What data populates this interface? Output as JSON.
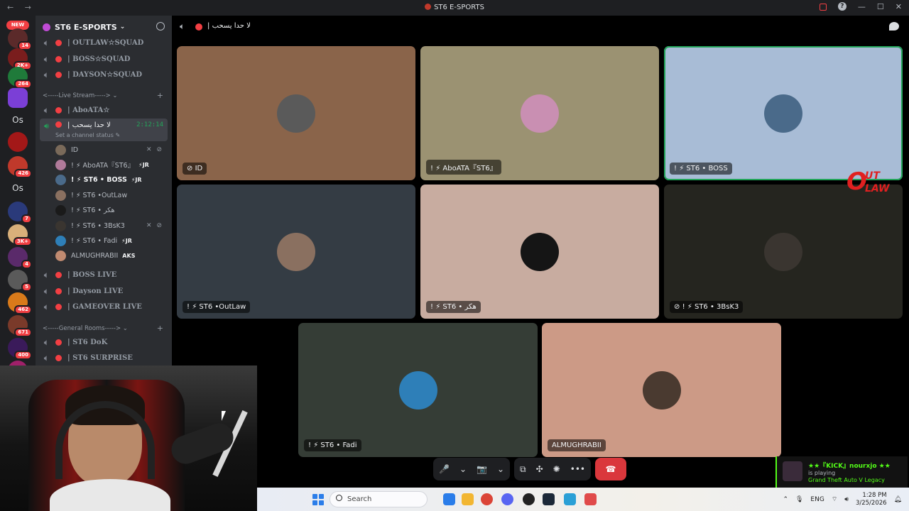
{
  "window": {
    "title": "ST6 E-SPORTS",
    "nav": "← →"
  },
  "guilds": {
    "new_label": "NEW",
    "items": [
      {
        "badge": "14",
        "color": "#5b2a2a"
      },
      {
        "badge": "2K+",
        "color": "#7a1d1d"
      },
      {
        "badge": "264",
        "color": "#1f7a3a"
      },
      {
        "badge": "",
        "color": "#7b3fd6"
      },
      {
        "label": "Os"
      },
      {
        "badge": "",
        "color": "#a31818"
      },
      {
        "badge": "426",
        "color": "#c0392b"
      },
      {
        "label": "Os"
      },
      {
        "badge": "7",
        "color": "#2a3a7a"
      },
      {
        "badge": "3K+",
        "color": "#d9b07a"
      },
      {
        "badge": "4",
        "color": "#5a2a6a"
      },
      {
        "badge": "5",
        "color": "#5a5a5a"
      },
      {
        "badge": "462",
        "color": "#d97a1a"
      },
      {
        "badge": "671",
        "color": "#7a3a2a"
      },
      {
        "badge": "400",
        "color": "#3a1a5a"
      },
      {
        "badge": "686",
        "color": "#a0206a"
      }
    ]
  },
  "server": {
    "name": "ST6 E-SPORTS"
  },
  "channels_top": [
    {
      "name": "| OUTLAW☆SQUAD"
    },
    {
      "name": "| BOSS☆SQUAD"
    },
    {
      "name": "| DAYSON☆SQUAD"
    }
  ],
  "category_live": {
    "label": "<-----Live Stream----->"
  },
  "channel_aboata": {
    "name": "| AboATA☆"
  },
  "active_channel": {
    "name": "| لا حدا يسحب",
    "timer": "2:12:14",
    "status_hint": "Set a channel status ✎"
  },
  "voice_users": [
    {
      "name": "ID",
      "tag": "",
      "icons": "✕ ⊘",
      "bold": false
    },
    {
      "name": "! ⚡ AboATA『ST6』",
      "tag": "⚡JR",
      "icons": "",
      "bold": false
    },
    {
      "name": "! ⚡ ST6 • BOSS",
      "tag": "⚡JR",
      "icons": "",
      "bold": true
    },
    {
      "name": "! ⚡ ST6 •OutLaw",
      "tag": "",
      "icons": "",
      "bold": false
    },
    {
      "name": "! ⚡ ST6 • هكر",
      "tag": "",
      "icons": "",
      "bold": false
    },
    {
      "name": "! ⚡ ST6 • 3BsK3",
      "tag": "",
      "icons": "✕ ⊘",
      "bold": false
    },
    {
      "name": "! ⚡ ST6 • Fadi",
      "tag": "⚡JR",
      "icons": "",
      "bold": false
    },
    {
      "name": "ALMUGHRABII",
      "tag": "AKS",
      "icons": "",
      "bold": false
    }
  ],
  "channels_live": [
    {
      "name": "| BOSS LIVE"
    },
    {
      "name": "| Dayson LIVE"
    },
    {
      "name": "| GAMEOVER LIVE"
    }
  ],
  "category_general": {
    "label": "<-----General Rooms----->"
  },
  "channels_general": [
    {
      "name": "| ST6 DoK"
    },
    {
      "name": "| ST6 SURPRISE"
    }
  ],
  "call_header": {
    "channel": "| لا حدا يسحب"
  },
  "tiles": [
    {
      "label": "ID",
      "icon": "⊘",
      "bg": "#8a644a",
      "avatar": "#5a5a5a"
    },
    {
      "label": "! ⚡ AboATA『ST6』",
      "icon": "",
      "bg": "#9b9272",
      "avatar": "#c98fb2"
    },
    {
      "label": "! ⚡ ST6 • BOSS",
      "icon": "",
      "bg": "#a8bcd6",
      "avatar": "#4a6a8a",
      "speaking": true
    },
    {
      "label": "! ⚡ ST6 •OutLaw",
      "icon": "",
      "bg": "#343c44",
      "avatar": "#8a7060"
    },
    {
      "label": "! ⚡ ST6 • هكر",
      "icon": "",
      "bg": "#c8aca0",
      "avatar": "#151515"
    },
    {
      "label": "! ⚡ ST6 • 3BsK3",
      "icon": "⊘",
      "bg": "#25251f",
      "avatar": "#3a3530"
    },
    {
      "label": "! ⚡ ST6 • Fadi",
      "icon": "",
      "bg": "#353d36",
      "avatar": "#2e7fb8"
    },
    {
      "label": "ALMUGHRABII",
      "icon": "",
      "bg": "#cc9a86",
      "avatar": "#4a3a30"
    }
  ],
  "logo": {
    "o": "O",
    "line1": "UT",
    "line2": "LAW"
  },
  "controls": {
    "mic": "🎤",
    "camera": "📷",
    "share": "⧉",
    "activity": "✣",
    "soundboard": "✺",
    "more": "•••",
    "hangup": "☎",
    "chevron": "⌄"
  },
  "taskbar": {
    "search_placeholder": "Search",
    "lang": "ENG",
    "time": "1:28 PM",
    "date": "3/25/2026"
  },
  "notification": {
    "title": "★★『KICK』nourxjo ★★",
    "subtitle": "is playing",
    "game": "Grand Theft Auto V Legacy"
  }
}
